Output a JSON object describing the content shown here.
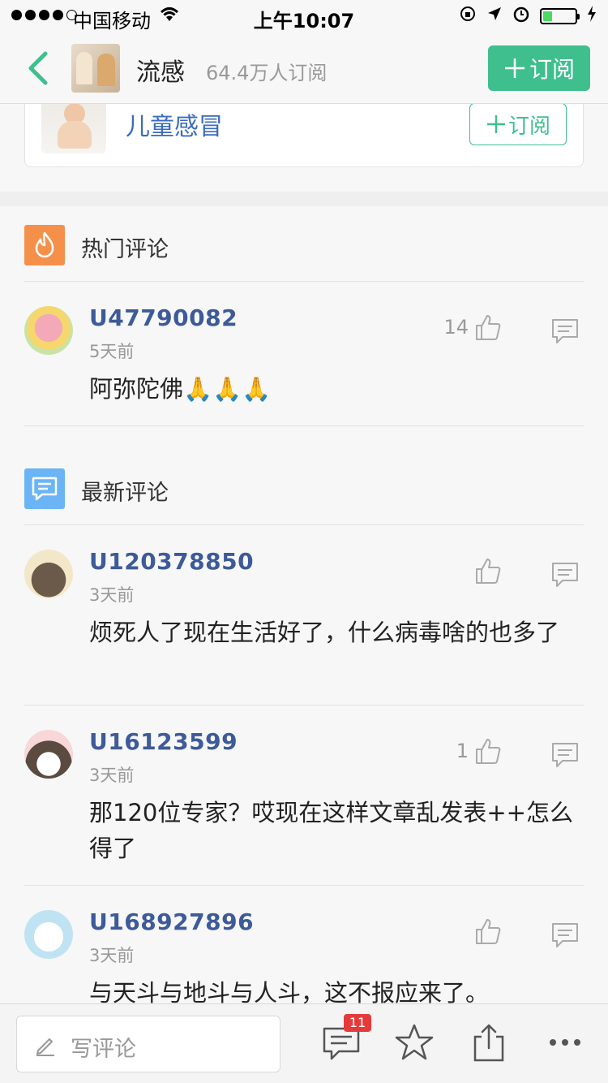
{
  "status_bar": {
    "carrier": "中国移动",
    "time": "上午10:07"
  },
  "nav": {
    "title": "流感",
    "subscribers": "64.4万人订阅",
    "subscribe_label": "订阅"
  },
  "related_topic": {
    "name": "儿童感冒",
    "subscribe_label": "订阅"
  },
  "hot_section": {
    "label": "热门评论",
    "comments": [
      {
        "user": "U47790082",
        "time": "5天前",
        "text": "阿弥陀佛🙏🙏🙏",
        "likes": "14"
      }
    ]
  },
  "new_section": {
    "label": "最新评论",
    "comments": [
      {
        "user": "U120378850",
        "time": "3天前",
        "text": "烦死人了现在生活好了，什么病毒啥的也多了",
        "likes": ""
      },
      {
        "user": "U16123599",
        "time": "3天前",
        "text": "那120位专家？哎现在这样文章乱发表++怎么得了",
        "likes": "1"
      },
      {
        "user": "U168927896",
        "time": "3天前",
        "text": "与天斗与地斗与人斗，这不报应来了。",
        "likes": ""
      }
    ]
  },
  "toolbar": {
    "write_placeholder": "写评论",
    "comment_count": "11"
  },
  "icons": {
    "back": "chevron-left-icon",
    "like": "thumbs-up-icon",
    "reply": "chat-bubble-icon",
    "star": "star-icon",
    "share": "share-icon",
    "more": "more-dots-icon"
  },
  "colors": {
    "accent_green": "#3fbf8e",
    "username_blue": "#3d5a99",
    "hot_orange": "#f5904a",
    "new_blue": "#6bb4f5",
    "badge_red": "#e63a3a"
  }
}
